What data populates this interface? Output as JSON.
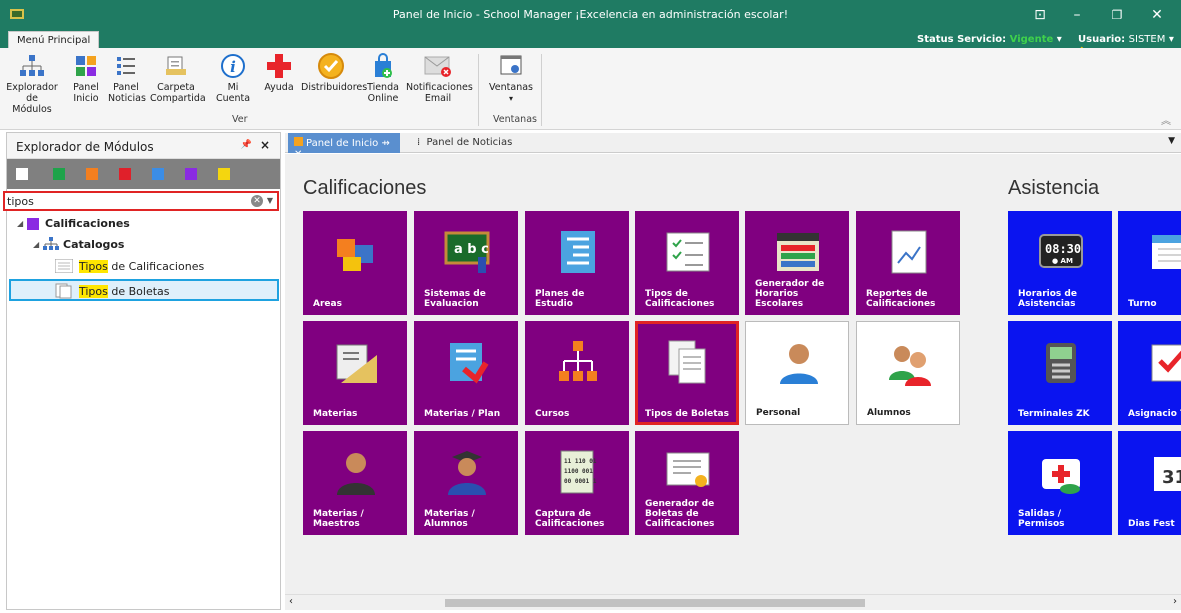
{
  "window": {
    "title": "Panel de Inicio - School Manager ¡Excelencia en administración escolar!"
  },
  "ribbon_tab": "Menú Principal",
  "status": {
    "label": "Status Servicio:",
    "value": "Vigente",
    "user_label": "Usuario:",
    "user_value": "SISTEM"
  },
  "ribbon": {
    "buttons": [
      {
        "label": "Explorador de Módulos",
        "icon": "modules-icon"
      },
      {
        "label": "Panel Inicio",
        "icon": "panel-icon"
      },
      {
        "label": "Panel Noticias",
        "icon": "news-icon"
      },
      {
        "label": "Carpeta Compartida",
        "icon": "folder-icon"
      },
      {
        "label": "Mi Cuenta",
        "icon": "info-icon"
      },
      {
        "label": "Ayuda",
        "icon": "help-cross-icon"
      },
      {
        "label": "Distribuidores",
        "icon": "distributor-icon"
      },
      {
        "label": "Tienda Online",
        "icon": "store-icon"
      },
      {
        "label": "Notificaciones Email",
        "icon": "email-icon"
      },
      {
        "label": "Ventanas",
        "icon": "windows-icon"
      }
    ],
    "groups": [
      "Ver",
      "Ventanas"
    ]
  },
  "explorer": {
    "title": "Explorador de Módulos",
    "search_value": "tipos",
    "tree": {
      "root": "Calificaciones",
      "child": "Catalogos",
      "items": [
        {
          "match": "Tipos",
          "rest": " de Calificaciones"
        },
        {
          "match": "Tipos",
          "rest": " de Boletas"
        }
      ]
    },
    "swatch_colors": [
      "#ffffff",
      "#1ea34a",
      "#f47f1f",
      "#e0202a",
      "#3b8de6",
      "#8a2be2",
      "#f4d60f"
    ]
  },
  "tabs": [
    "Panel de Inicio",
    "Panel de Noticias"
  ],
  "sections": {
    "calificaciones": "Calificaciones",
    "asistencia": "Asistencia"
  },
  "tiles_calif": [
    {
      "label": "Areas",
      "style": "purple",
      "icon": "puzzle-icon"
    },
    {
      "label": "Sistemas de Evaluacion",
      "style": "purple",
      "icon": "chalkboard-icon"
    },
    {
      "label": "Planes de Estudio",
      "style": "purple",
      "icon": "plan-icon"
    },
    {
      "label": "Tipos de Calificaciones",
      "style": "purple",
      "icon": "checklist-icon"
    },
    {
      "label": "Generador de Horarios Escolares",
      "style": "purple",
      "icon": "schedule-icon"
    },
    {
      "label": "Reportes de Calificaciones",
      "style": "purple",
      "icon": "report-icon"
    },
    {
      "label": "Materias",
      "style": "purple",
      "icon": "ruler-icon"
    },
    {
      "label": "Materias / Plan",
      "style": "purple",
      "icon": "subject-plan-icon"
    },
    {
      "label": "Cursos",
      "style": "purple",
      "icon": "hierarchy-icon"
    },
    {
      "label": "Tipos de Boletas",
      "style": "purple",
      "icon": "documents-icon"
    },
    {
      "label": "Personal",
      "style": "white",
      "icon": "person-icon"
    },
    {
      "label": "Alumnos",
      "style": "white",
      "icon": "students-icon"
    },
    {
      "label": "Materias / Maestros",
      "style": "purple",
      "icon": "teacher-icon"
    },
    {
      "label": "Materias / Alumnos",
      "style": "purple",
      "icon": "graduate-icon"
    },
    {
      "label": "Captura de Calificaciones",
      "style": "purple",
      "icon": "binary-doc-icon"
    },
    {
      "label": "Generador de Boletas de Calificaciones",
      "style": "purple",
      "icon": "certificate-icon"
    }
  ],
  "tiles_asist": [
    {
      "label": "Horarios de Asistencias",
      "icon": "clock-icon"
    },
    {
      "label": "Turno",
      "icon": "calendar-icon"
    },
    {
      "label": "Terminales ZK",
      "icon": "terminal-icon"
    },
    {
      "label": "Asignacio Turnos",
      "icon": "assign-icon"
    },
    {
      "label": "Salidas / Permisos",
      "icon": "medkit-icon"
    },
    {
      "label": "Dias Fest",
      "icon": "holiday-icon"
    }
  ]
}
